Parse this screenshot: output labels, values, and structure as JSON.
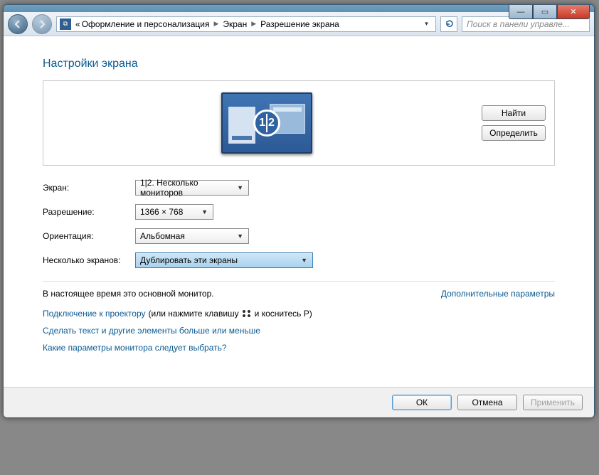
{
  "titlebar": {
    "minimize_tip": "—",
    "maximize_tip": "▭",
    "close_tip": "✕"
  },
  "breadcrumb": {
    "prefix": "«",
    "item1": "Оформление и персонализация",
    "item2": "Экран",
    "item3": "Разрешение экрана"
  },
  "search": {
    "placeholder": "Поиск в панели управле..."
  },
  "page": {
    "heading": "Настройки экрана"
  },
  "preview": {
    "num": "1|2",
    "find_btn": "Найти",
    "identify_btn": "Определить"
  },
  "form": {
    "display_label": "Экран:",
    "display_value": "1|2. Несколько мониторов",
    "resolution_label": "Разрешение:",
    "resolution_value": "1366 × 768",
    "orientation_label": "Ориентация:",
    "orientation_value": "Альбомная",
    "multiple_label": "Несколько экранов:",
    "multiple_value": "Дублировать эти экраны"
  },
  "note": {
    "primary": "В настоящее время это основной монитор.",
    "advanced_link": "Дополнительные параметры"
  },
  "links": {
    "projector_link": "Подключение к проектору",
    "projector_tail_pre": "(или нажмите клавишу",
    "projector_tail_post": "и коснитесь P)",
    "text_size": "Сделать текст и другие элементы больше или меньше",
    "which": "Какие параметры монитора следует выбрать?"
  },
  "buttons": {
    "ok": "ОК",
    "cancel": "Отмена",
    "apply": "Применить"
  }
}
